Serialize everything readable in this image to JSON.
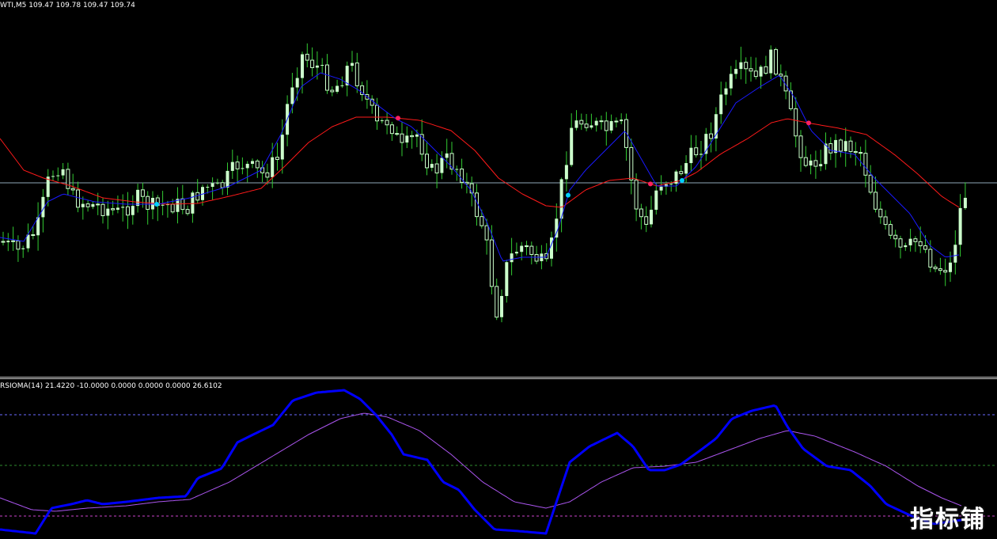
{
  "main_chart": {
    "header": "WTI,M5  109.47 109.78 109.47 109.74",
    "symbol": "WTI",
    "timeframe": "M5",
    "ohlc": {
      "open": 109.47,
      "high": 109.78,
      "low": 109.47,
      "close": 109.74
    },
    "colors": {
      "background": "#000000",
      "candle": "#ccffcc",
      "candle_wick": "#33cc33",
      "fast_ma": "#1a1aff",
      "slow_ma": "#ff1a1a",
      "bid_line": "#8fa8b8",
      "cross_up": "#00d0ff",
      "cross_down": "#ff2060"
    }
  },
  "indicator": {
    "header": "RSIOMA(14) 21.4220 -10.0000 0.0000 0.0000 0.0000 26.6102",
    "name": "RSIOMA(14)",
    "values": [
      21.422,
      -10.0,
      0.0,
      0.0,
      0.0,
      26.6102
    ],
    "colors": {
      "main_line": "#0000ff",
      "signal_line": "#aa55ee",
      "upper_level": "#6a6aff",
      "middle_level": "#2e8b2e",
      "lower_level": "#cc44cc"
    }
  },
  "watermark": "指标铺"
}
